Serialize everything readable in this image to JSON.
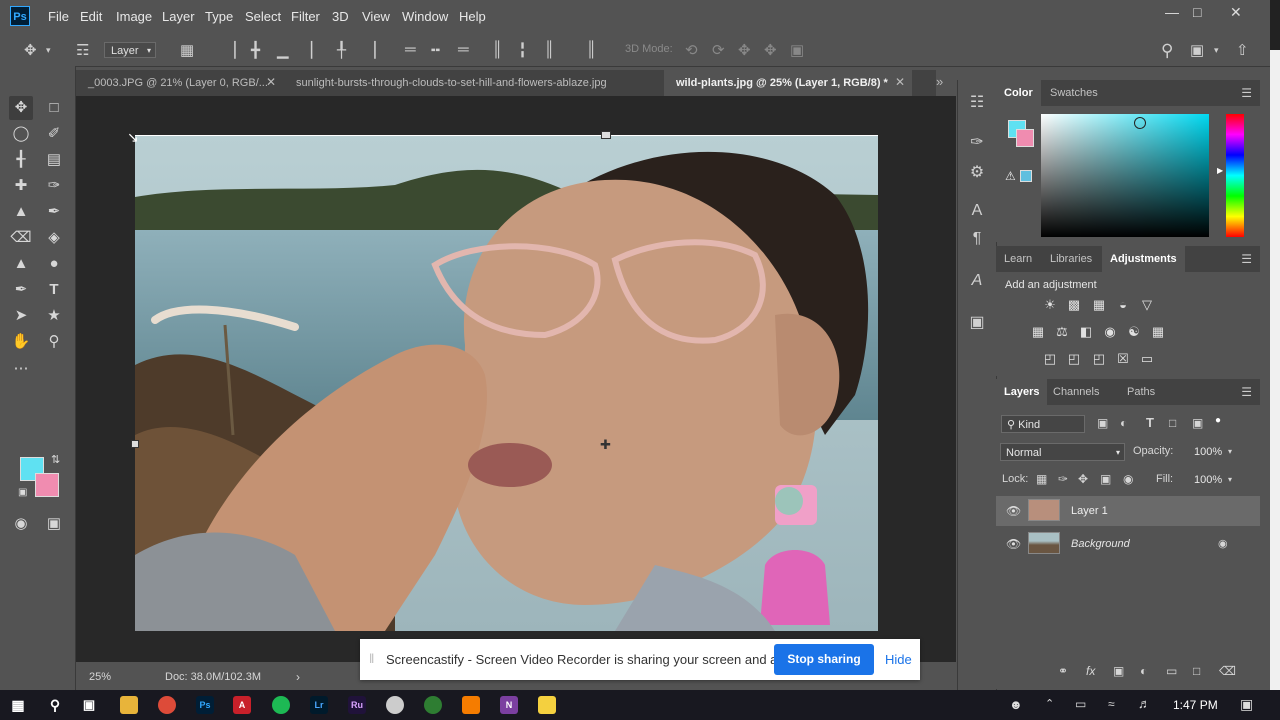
{
  "app": {
    "logo": "Ps"
  },
  "menu": [
    "File",
    "Edit",
    "Image",
    "Layer",
    "Type",
    "Select",
    "Filter",
    "3D",
    "View",
    "Window",
    "Help"
  ],
  "options_bar": {
    "auto_select": "Layer",
    "mode_3d": "3D Mode:"
  },
  "tabs": [
    {
      "label": "_0003.JPG @ 21% (Layer 0, RGB/...",
      "active": false
    },
    {
      "label": "sunlight-bursts-through-clouds-to-set-hill-and-flowers-ablaze.jpg",
      "active": false
    },
    {
      "label": "wild-plants.jpg @ 25% (Layer 1, RGB/8) *",
      "active": true
    }
  ],
  "status": {
    "zoom": "25%",
    "doc": "Doc: 38.0M/102.3M"
  },
  "colors": {
    "foreground": "#5fe1f2",
    "background": "#f08cb0",
    "accent": "#1a73e8"
  },
  "color_panel": {
    "tabs": [
      "Color",
      "Swatches"
    ],
    "active": "Color"
  },
  "adjustments_panel": {
    "tabs": [
      "Learn",
      "Libraries",
      "Adjustments"
    ],
    "active": "Adjustments",
    "heading": "Add an adjustment"
  },
  "layers_panel": {
    "tabs": [
      "Layers",
      "Channels",
      "Paths"
    ],
    "active": "Layers",
    "filter": "Kind",
    "blend_mode": "Normal",
    "opacity_label": "Opacity:",
    "opacity": "100%",
    "lock_label": "Lock:",
    "fill_label": "Fill:",
    "fill": "100%",
    "layers": [
      {
        "name": "Layer 1",
        "selected": true
      },
      {
        "name": "Background",
        "selected": false,
        "locked": true
      }
    ]
  },
  "screencastify": {
    "message": "Screencastify - Screen Video Recorder is sharing your screen and audio.",
    "stop_label": "Stop sharing",
    "hide_label": "Hide"
  },
  "taskbar": {
    "time": "1:47 PM"
  }
}
